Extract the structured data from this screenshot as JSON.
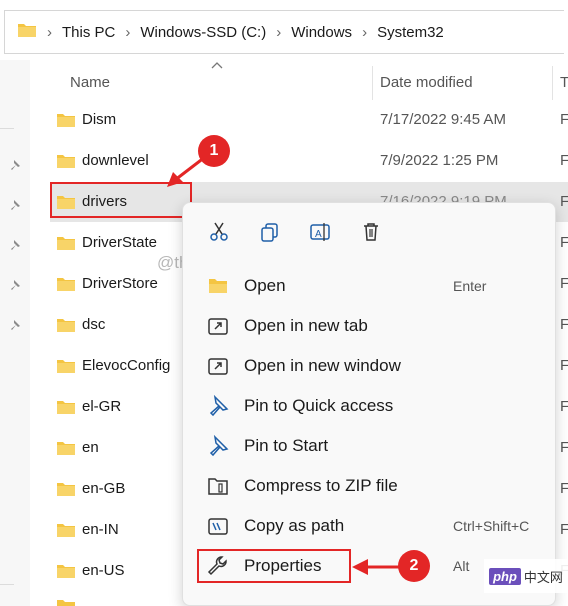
{
  "breadcrumb": [
    "This PC",
    "Windows-SSD (C:)",
    "Windows",
    "System32"
  ],
  "columns": {
    "name": "Name",
    "date": "Date modified",
    "type": "Ty"
  },
  "files": [
    {
      "name": "Dism",
      "date": "7/17/2022 9:45 AM",
      "type": "F"
    },
    {
      "name": "downlevel",
      "date": "7/9/2022 1:25 PM",
      "type": "F"
    },
    {
      "name": "drivers",
      "date": "7/16/2022 9:19 PM",
      "type": "F"
    },
    {
      "name": "DriverState",
      "date": "",
      "type": "F"
    },
    {
      "name": "DriverStore",
      "date": "",
      "type": "F"
    },
    {
      "name": "dsc",
      "date": "",
      "type": "F"
    },
    {
      "name": "ElevocConfig",
      "date": "",
      "type": "F"
    },
    {
      "name": "el-GR",
      "date": "",
      "type": "F"
    },
    {
      "name": "en",
      "date": "",
      "type": "F"
    },
    {
      "name": "en-GB",
      "date": "",
      "type": "F"
    },
    {
      "name": "en-IN",
      "date": "",
      "type": "F"
    },
    {
      "name": "en-US",
      "date": "",
      "type": "F"
    }
  ],
  "watermark": "@thegeekpage.com",
  "context_menu": {
    "items": [
      {
        "label": "Open",
        "shortcut": "Enter"
      },
      {
        "label": "Open in new tab",
        "shortcut": ""
      },
      {
        "label": "Open in new window",
        "shortcut": ""
      },
      {
        "label": "Pin to Quick access",
        "shortcut": ""
      },
      {
        "label": "Pin to Start",
        "shortcut": ""
      },
      {
        "label": "Compress to ZIP file",
        "shortcut": ""
      },
      {
        "label": "Copy as path",
        "shortcut": "Ctrl+Shift+C"
      },
      {
        "label": "Properties",
        "shortcut": "Alt"
      }
    ]
  },
  "annotations": {
    "step1": "1",
    "step2": "2"
  },
  "php_badge": {
    "brand": "php",
    "site": "中文网"
  },
  "colors": {
    "accent_red": "#e32626",
    "folder": "#f4c542",
    "selection": "#e6e6e6"
  }
}
